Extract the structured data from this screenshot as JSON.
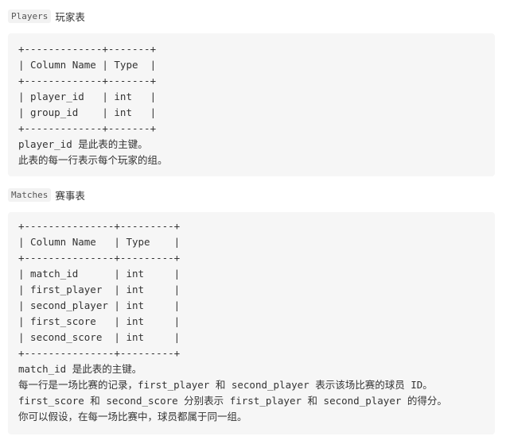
{
  "players_section": {
    "code_name": "Players",
    "title": "玩家表",
    "lines": [
      "+-------------+-------+",
      "| Column Name | Type  |",
      "+-------------+-------+",
      "| player_id   | int   |",
      "| group_id    | int   |",
      "+-------------+-------+",
      "player_id 是此表的主键。",
      "此表的每一行表示每个玩家的组。"
    ]
  },
  "matches_section": {
    "code_name": "Matches",
    "title": "赛事表",
    "lines": [
      "+---------------+---------+",
      "| Column Name   | Type    |",
      "+---------------+---------+",
      "| match_id      | int     |",
      "| first_player  | int     |",
      "| second_player | int     |",
      "| first_score   | int     |",
      "| second_score  | int     |",
      "+---------------+---------+",
      "match_id 是此表的主键。",
      "每一行是一场比赛的记录，first_player 和 second_player 表示该场比赛的球员 ID。",
      "first_score 和 second_score 分别表示 first_player 和 second_player 的得分。",
      "你可以假设，在每一场比赛中，球员都属于同一组。"
    ]
  }
}
